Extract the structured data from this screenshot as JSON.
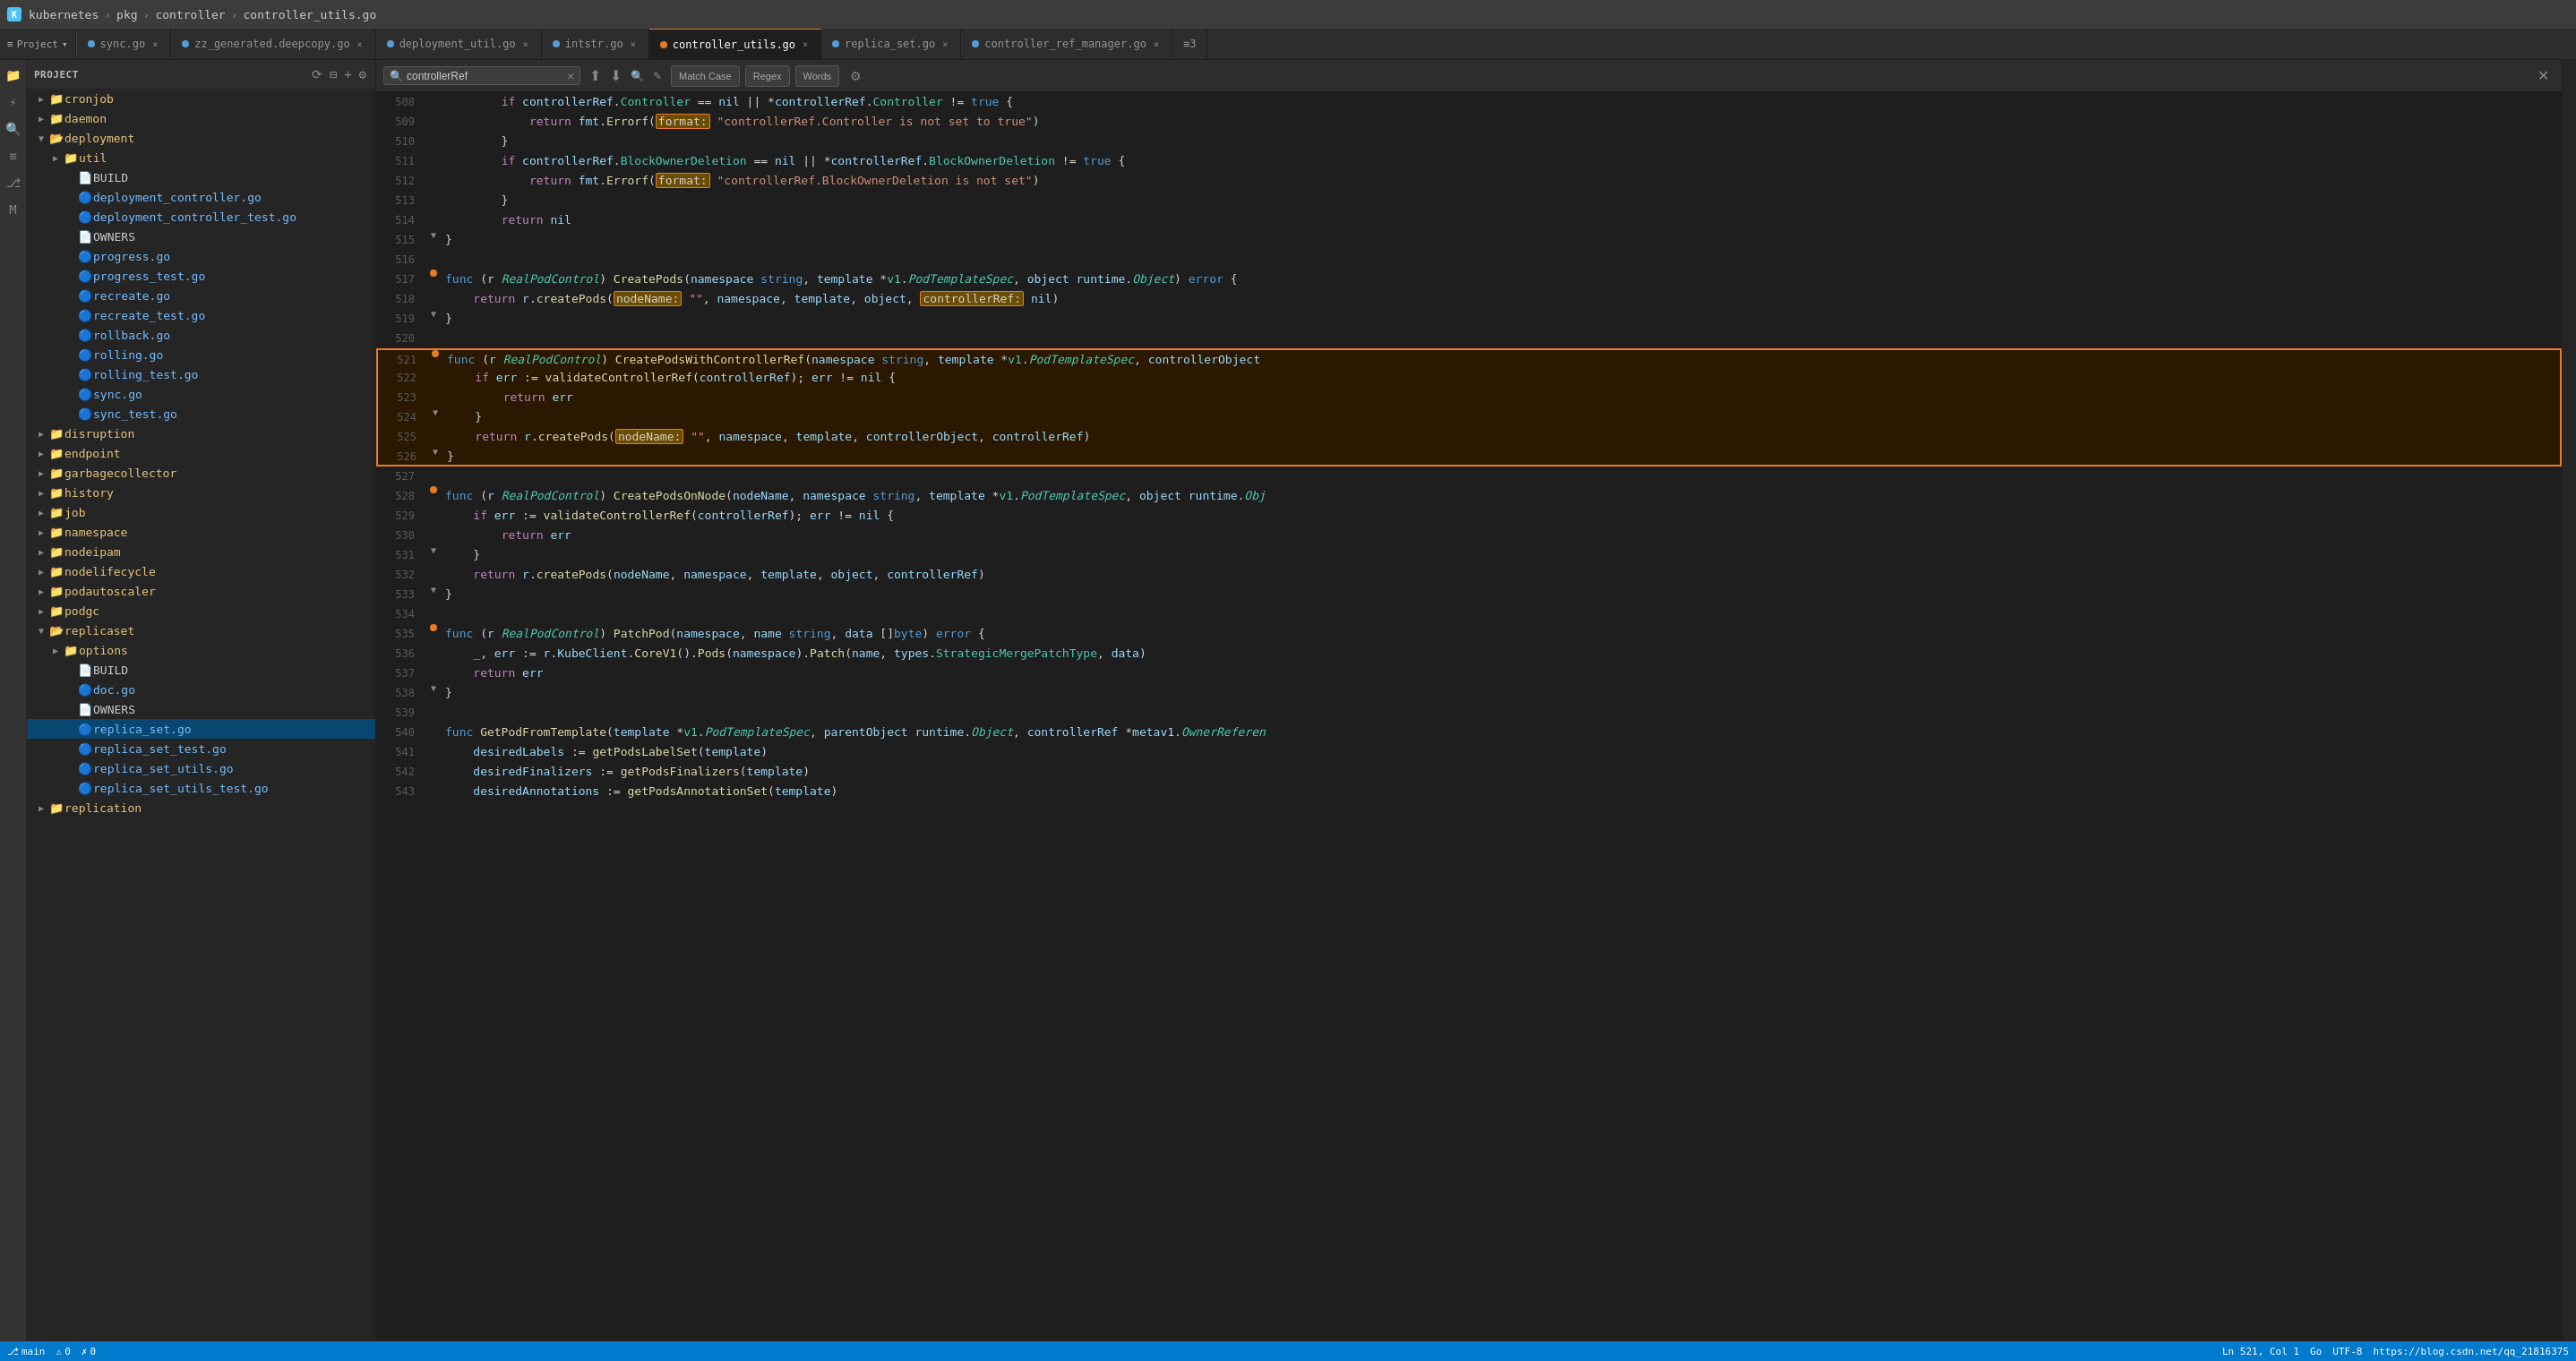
{
  "titleBar": {
    "icon": "K",
    "parts": [
      "kubernetes",
      "pkg",
      "controller",
      "controller_utils.go"
    ]
  },
  "tabs": [
    {
      "label": "sync.go",
      "color": "#569cd6",
      "active": false,
      "modified": false
    },
    {
      "label": "zz_generated.deepcopy.go",
      "color": "#569cd6",
      "active": false,
      "modified": false
    },
    {
      "label": "deployment_util.go",
      "color": "#569cd6",
      "active": false,
      "modified": false
    },
    {
      "label": "intstr.go",
      "color": "#569cd6",
      "active": false,
      "modified": false
    },
    {
      "label": "controller_utils.go",
      "color": "#e77c26",
      "active": true,
      "modified": false
    },
    {
      "label": "replica_set.go",
      "color": "#569cd6",
      "active": false,
      "modified": false
    },
    {
      "label": "controller_ref_manager.go",
      "color": "#569cd6",
      "active": false,
      "modified": false
    },
    {
      "label": "≡3",
      "color": "#888",
      "active": false,
      "modified": false
    }
  ],
  "fileTree": {
    "header": "Project",
    "items": [
      {
        "depth": 0,
        "type": "folder",
        "label": "cronjob",
        "open": false
      },
      {
        "depth": 0,
        "type": "folder",
        "label": "daemon",
        "open": false
      },
      {
        "depth": 0,
        "type": "folder",
        "label": "deployment",
        "open": true
      },
      {
        "depth": 1,
        "type": "folder",
        "label": "util",
        "open": false
      },
      {
        "depth": 1,
        "type": "file-plain",
        "label": "BUILD"
      },
      {
        "depth": 1,
        "type": "file-go",
        "label": "deployment_controller.go"
      },
      {
        "depth": 1,
        "type": "file-go",
        "label": "deployment_controller_test.go"
      },
      {
        "depth": 1,
        "type": "file-plain",
        "label": "OWNERS"
      },
      {
        "depth": 1,
        "type": "file-go",
        "label": "progress.go"
      },
      {
        "depth": 1,
        "type": "file-go",
        "label": "progress_test.go"
      },
      {
        "depth": 1,
        "type": "file-go",
        "label": "recreate.go"
      },
      {
        "depth": 1,
        "type": "file-go",
        "label": "recreate_test.go"
      },
      {
        "depth": 1,
        "type": "file-go",
        "label": "rollback.go"
      },
      {
        "depth": 1,
        "type": "file-go",
        "label": "rolling.go"
      },
      {
        "depth": 1,
        "type": "file-go",
        "label": "rolling_test.go"
      },
      {
        "depth": 1,
        "type": "file-go",
        "label": "sync.go"
      },
      {
        "depth": 1,
        "type": "file-go",
        "label": "sync_test.go"
      },
      {
        "depth": 0,
        "type": "folder",
        "label": "disruption",
        "open": false
      },
      {
        "depth": 0,
        "type": "folder",
        "label": "endpoint",
        "open": false
      },
      {
        "depth": 0,
        "type": "folder",
        "label": "garbagecollector",
        "open": false
      },
      {
        "depth": 0,
        "type": "folder",
        "label": "history",
        "open": false
      },
      {
        "depth": 0,
        "type": "folder",
        "label": "job",
        "open": false
      },
      {
        "depth": 0,
        "type": "folder",
        "label": "namespace",
        "open": false
      },
      {
        "depth": 0,
        "type": "folder",
        "label": "nodeipam",
        "open": false
      },
      {
        "depth": 0,
        "type": "folder",
        "label": "nodelifecycle",
        "open": false
      },
      {
        "depth": 0,
        "type": "folder",
        "label": "podautoscaler",
        "open": false
      },
      {
        "depth": 0,
        "type": "folder",
        "label": "podgc",
        "open": false
      },
      {
        "depth": 0,
        "type": "folder",
        "label": "replicaset",
        "open": true
      },
      {
        "depth": 1,
        "type": "folder",
        "label": "options",
        "open": false
      },
      {
        "depth": 1,
        "type": "file-plain",
        "label": "BUILD"
      },
      {
        "depth": 1,
        "type": "file-go",
        "label": "doc.go"
      },
      {
        "depth": 1,
        "type": "file-plain",
        "label": "OWNERS"
      },
      {
        "depth": 1,
        "type": "file-go",
        "label": "replica_set.go",
        "selected": true
      },
      {
        "depth": 1,
        "type": "file-go",
        "label": "replica_set_test.go"
      },
      {
        "depth": 1,
        "type": "file-go",
        "label": "replica_set_utils.go"
      },
      {
        "depth": 1,
        "type": "file-go",
        "label": "replica_set_utils_test.go"
      },
      {
        "depth": 0,
        "type": "folder",
        "label": "replication",
        "open": false
      }
    ]
  },
  "searchBar": {
    "placeholder": "controllerRef",
    "value": "controllerRef",
    "matchCaseLabel": "Match Case",
    "regexLabel": "Regex",
    "wordsLabel": "Words"
  },
  "codeLines": [
    {
      "num": 508,
      "indent": 2,
      "tokens": "  <span class='kw2'>if</span> <span class='param'>controllerRef</span>.<span class='prop'>Controller</span> == <span class='param'>nil</span> || *<span class='param'>controllerRef</span>.<span class='prop'>Controller</span> != <span class='kw'>true</span> {"
    },
    {
      "num": 509,
      "indent": 3,
      "tokens": "    <span class='kw2'>return</span> <span class='param'>fmt</span>.<span class='fn'>Errorf</span>(<span class='highlight-tag'>format:</span> <span class='str'>\"controllerRef.Controller is not set to true\"</span>)"
    },
    {
      "num": 510,
      "indent": 2,
      "tokens": "  }"
    },
    {
      "num": 511,
      "indent": 2,
      "tokens": "  <span class='kw2'>if</span> <span class='param'>controllerRef</span>.<span class='prop'>BlockOwnerDeletion</span> == <span class='param'>nil</span> || *<span class='param'>controllerRef</span>.<span class='prop'>BlockOwnerDeletion</span> != <span class='kw'>true</span> {"
    },
    {
      "num": 512,
      "indent": 3,
      "tokens": "    <span class='kw2'>return</span> <span class='param'>fmt</span>.<span class='fn'>Errorf</span>(<span class='highlight-tag'>format:</span> <span class='str'>\"controllerRef.BlockOwnerDeletion is not set\"</span>)"
    },
    {
      "num": 513,
      "indent": 2,
      "tokens": "  }"
    },
    {
      "num": 514,
      "indent": 2,
      "tokens": "  <span class='kw2'>return</span> <span class='param'>nil</span>"
    },
    {
      "num": 515,
      "indent": 1,
      "tokens": "}"
    },
    {
      "num": 516,
      "indent": 0,
      "tokens": ""
    },
    {
      "num": 517,
      "indent": 1,
      "tokens": "<span class='kw'>func</span> (<span class='param'>r</span> <span class='type-italic'>RealPodControl</span>) <span class='fn'>CreatePods</span>(<span class='param'>namespace</span> <span class='kw'>string</span>, <span class='param'>template</span> *<span class='type'>v1</span>.<span class='type-italic'>PodTemplateSpec</span>, <span class='param'>object</span> <span class='param'>runtime</span>.<span class='type-italic'>Object</span>) <span class='kw'>error</span> {",
      "dot": true
    },
    {
      "num": 518,
      "indent": 2,
      "tokens": "  <span class='kw2'>return</span> <span class='param'>r</span>.<span class='fn'>createPods</span>(<span class='highlight-tag'>nodeName:</span> <span class='str'>\"\"</span>, <span class='param'>namespace</span>, <span class='param'>template</span>, <span class='param'>object</span>, <span class='highlight-tag'>controllerRef:</span> <span class='param'>nil</span>)"
    },
    {
      "num": 519,
      "indent": 1,
      "tokens": "}"
    },
    {
      "num": 520,
      "indent": 0,
      "tokens": ""
    },
    {
      "num": 521,
      "indent": 1,
      "tokens": "<span class='kw'>func</span> (<span class='param'>r</span> <span class='type-italic'>RealPodControl</span>) <span class='fn'>CreatePodsWithControllerRef</span>(<span class='param'>namespace</span> <span class='kw'>string</span>, <span class='param'>template</span> *<span class='type'>v1</span>.<span class='type-italic'>PodTemplateSpec</span>, <span class='param'>controllerObject</span>",
      "outlineStart": true,
      "dot": true
    },
    {
      "num": 522,
      "indent": 2,
      "tokens": "  <span class='kw2'>if</span> <span class='param'>err</span> := <span class='fn'>validateControllerRef</span>(<span class='param'>controllerRef</span>); <span class='param'>err</span> != <span class='param'>nil</span> {",
      "outlineMid": true
    },
    {
      "num": 523,
      "indent": 3,
      "tokens": "    <span class='kw2'>return</span> <span class='param'>err</span>",
      "outlineMid": true
    },
    {
      "num": 524,
      "indent": 2,
      "tokens": "  }",
      "outlineMid": true
    },
    {
      "num": 525,
      "indent": 2,
      "tokens": "  <span class='kw2'>return</span> <span class='param'>r</span>.<span class='fn'>createPods</span>(<span class='highlight-tag'>nodeName:</span> <span class='str'>\"\"</span>, <span class='param'>namespace</span>, <span class='param'>template</span>, <span class='param'>controllerObject</span>, <span class='param'>controllerRef</span>)",
      "outlineMid": true
    },
    {
      "num": 526,
      "indent": 1,
      "tokens": "}",
      "outlineEnd": true
    },
    {
      "num": 527,
      "indent": 0,
      "tokens": ""
    },
    {
      "num": 528,
      "indent": 1,
      "tokens": "<span class='kw'>func</span> (<span class='param'>r</span> <span class='type-italic'>RealPodControl</span>) <span class='fn'>CreatePodsOnNode</span>(<span class='param'>nodeName</span>, <span class='param'>namespace</span> <span class='kw'>string</span>, <span class='param'>template</span> *<span class='type'>v1</span>.<span class='type-italic'>PodTemplateSpec</span>, <span class='param'>object</span> <span class='param'>runtime</span>.<span class='type-italic'>Obj</span>",
      "dot": true
    },
    {
      "num": 529,
      "indent": 2,
      "tokens": "  <span class='kw2'>if</span> <span class='param'>err</span> := <span class='fn'>validateControllerRef</span>(<span class='param'>controllerRef</span>); <span class='param'>err</span> != <span class='param'>nil</span> {"
    },
    {
      "num": 530,
      "indent": 3,
      "tokens": "    <span class='kw2'>return</span> <span class='param'>err</span>"
    },
    {
      "num": 531,
      "indent": 2,
      "tokens": "  }"
    },
    {
      "num": 532,
      "indent": 2,
      "tokens": "  <span class='kw2'>return</span> <span class='param'>r</span>.<span class='fn'>createPods</span>(<span class='param'>nodeName</span>, <span class='param'>namespace</span>, <span class='param'>template</span>, <span class='param'>object</span>, <span class='param'>controllerRef</span>)"
    },
    {
      "num": 533,
      "indent": 1,
      "tokens": "}"
    },
    {
      "num": 534,
      "indent": 0,
      "tokens": ""
    },
    {
      "num": 535,
      "indent": 1,
      "tokens": "<span class='kw'>func</span> (<span class='param'>r</span> <span class='type-italic'>RealPodControl</span>) <span class='fn'>PatchPod</span>(<span class='param'>namespace</span>, <span class='param'>name</span> <span class='kw'>string</span>, <span class='param'>data</span> []<span class='kw'>byte</span>) <span class='kw'>error</span> {",
      "dot": true
    },
    {
      "num": 536,
      "indent": 2,
      "tokens": "  _, <span class='param'>err</span> := <span class='param'>r</span>.<span class='param'>KubeClient</span>.<span class='fn'>CoreV1</span>().<span class='fn'>Pods</span>(<span class='param'>namespace</span>).<span class='fn'>Patch</span>(<span class='param'>name</span>, <span class='param'>types</span>.<span class='type'>StrategicMergePatchType</span>, <span class='param'>data</span>)"
    },
    {
      "num": 537,
      "indent": 2,
      "tokens": "  <span class='kw2'>return</span> <span class='param'>err</span>"
    },
    {
      "num": 538,
      "indent": 1,
      "tokens": "}"
    },
    {
      "num": 539,
      "indent": 0,
      "tokens": ""
    },
    {
      "num": 540,
      "indent": 1,
      "tokens": "<span class='kw'>func</span> <span class='fn'>GetPodFromTemplate</span>(<span class='param'>template</span> *<span class='type'>v1</span>.<span class='type-italic'>PodTemplateSpec</span>, <span class='param'>parentObject</span> <span class='param'>runtime</span>.<span class='type-italic'>Object</span>, <span class='param'>controllerRef</span> *<span class='param'>metav1</span>.<span class='type-italic'>OwnerReferen</span>"
    },
    {
      "num": 541,
      "indent": 2,
      "tokens": "  <span class='param'>desiredLabels</span> := <span class='fn'>getPodsLabelSet</span>(<span class='param'>template</span>)"
    },
    {
      "num": 542,
      "indent": 2,
      "tokens": "  <span class='param'>desiredFinalizers</span> := <span class='fn'>getPodsFinalizers</span>(<span class='param'>template</span>)"
    },
    {
      "num": 543,
      "indent": 2,
      "tokens": "  <span class='param'>desiredAnnotations</span> := <span class='fn'>getPodsAnnotationSet</span>(<span class='param'>template</span>)"
    }
  ],
  "statusBar": {
    "left": [
      "🔀",
      "main",
      "⚠ 0",
      "✗ 0"
    ],
    "right": [
      "Ln 521, Col 1",
      "Go",
      "UTF-8",
      "https://blog.csdn.net/qq_21816375"
    ]
  }
}
